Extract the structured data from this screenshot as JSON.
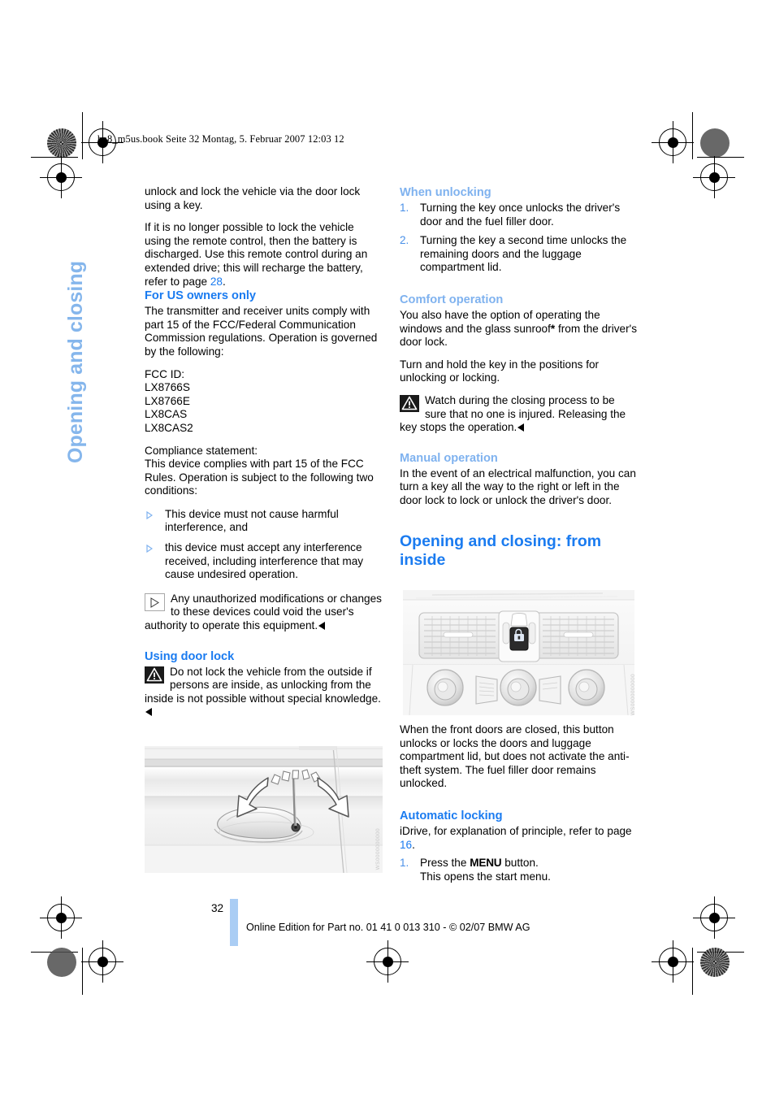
{
  "slug": "ba8_m5us.book  Seite 32  Montag, 5. Februar 2007  12:03 12",
  "chapter_tab": "Opening and closing",
  "colors": {
    "heading_blue": "#1a7bf0",
    "pale_blue": "#7fb2ef",
    "tab_blue": "#85b6ec",
    "bar_blue": "#aacdf4"
  },
  "left_column": {
    "para_1": "unlock and lock the vehicle via the door lock using a key.",
    "para_2_a": "If it is no longer possible to lock the vehicle using the remote control, then the battery is discharged. Use this remote control during an extended drive; this will recharge the battery, refer to page ",
    "para_2_ref": "28",
    "para_2_b": ".",
    "heading_us_owners": "For US owners only",
    "para_3": "The transmitter and receiver units comply with part 15 of the FCC/Federal Communication Commission regulations. Operation is governed by the following:",
    "fcc_label": "FCC ID:",
    "fcc_ids": [
      "LX8766S",
      "LX8766E",
      "LX8CAS",
      "LX8CAS2"
    ],
    "compliance_label": "Compliance statement:",
    "compliance_text": "This device complies with part 15 of the FCC Rules. Operation is subject to the following two conditions:",
    "bullets": [
      "This device must not cause harmful interference, and",
      "this device must accept any interference received, including interference that may cause undesired operation."
    ],
    "note_unauthorized": "Any unauthorized modifications or changes to these devices could void the user's authority to operate this equipment.",
    "heading_using_door_lock": "Using door lock",
    "warning_door_lock": "Do not lock the vehicle from the outside if persons are inside, as unlocking from the inside is not possible without special knowledge.",
    "figure_alt": "door-handle-key-turn-illustration",
    "figure_code": "WS0000000000"
  },
  "right_column": {
    "heading_when_unlocking": "When unlocking",
    "unlock_steps": [
      {
        "num": "1.",
        "text": "Turning the key once unlocks the driver's door and the fuel filler door."
      },
      {
        "num": "2.",
        "text": "Turning the key a second time unlocks the remaining doors and the luggage compartment lid."
      }
    ],
    "heading_comfort": "Comfort operation",
    "comfort_para_a": "You also have the option of operating the windows and the glass sunroof",
    "comfort_star": "*",
    "comfort_para_b": " from the driver's door lock.",
    "comfort_para_2": "Turn and hold the key in the positions for unlocking or locking.",
    "warning_comfort": "Watch during the closing process to be sure that no one is injured. Releasing the key stops the operation.",
    "heading_manual": "Manual operation",
    "manual_para": "In the event of an electrical malfunction, you can turn a key all the way to the right or left in the door lock to lock or unlock the driver's door.",
    "heading_main": "Opening and closing: from inside",
    "figure_alt": "center-console-lock-button-illustration",
    "figure_code": "WS0000000000",
    "figure_caption": "When the front doors are closed, this button unlocks or locks the doors and luggage compartment lid, but does not activate the anti-theft system. The fuel filler door remains unlocked.",
    "heading_auto_locking": "Automatic locking",
    "idrive_para_a": "iDrive, for explanation of principle, refer to page ",
    "idrive_ref": "16",
    "idrive_para_b": ".",
    "auto_steps": [
      {
        "num": "1.",
        "text_a": "Press the ",
        "key": "MENU",
        "text_b": " button.",
        "text_c": "This opens the start menu."
      }
    ]
  },
  "footer": {
    "page_number": "32",
    "copyright": "Online Edition for Part no. 01 41 0 013 310 - © 02/07 BMW AG"
  }
}
